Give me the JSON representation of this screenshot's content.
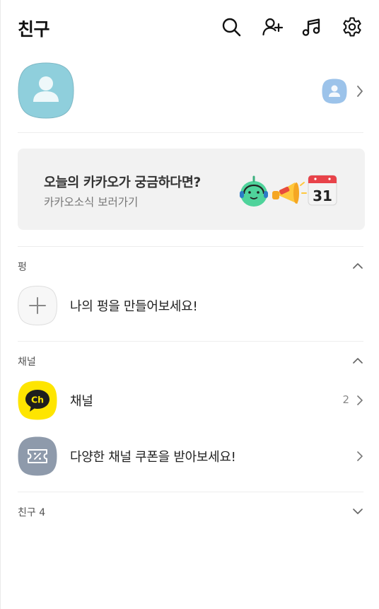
{
  "header": {
    "title": "친구"
  },
  "banner": {
    "title": "오늘의 카카오가 궁금하다면?",
    "subtitle": "카카오소식 보러가기",
    "calendar_day": "31"
  },
  "sections": {
    "pyeong": {
      "label": "펑",
      "create_label": "나의 펑을 만들어보세요!"
    },
    "channel": {
      "label": "채널",
      "channel_label": "채널",
      "channel_logo": "Ch",
      "channel_count": "2",
      "coupon_label": "다양한 채널 쿠폰을 받아보세요!"
    },
    "friends": {
      "label": "친구 4"
    }
  },
  "colors": {
    "accent": "#FEE500",
    "avatar_bg": "#8FCFDC",
    "mini_avatar_bg": "#9CC3EA",
    "coupon_bg": "#8E9AAB",
    "banner_bg": "#F2F2F2"
  },
  "icons": {
    "search": "search-icon",
    "add_friend": "add-friend-icon",
    "music": "music-icon",
    "settings": "gear-icon"
  }
}
